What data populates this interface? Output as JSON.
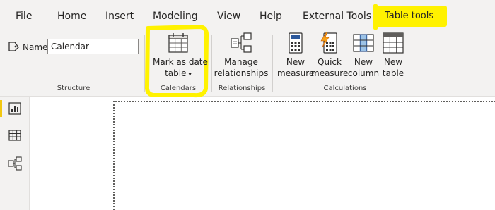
{
  "tabs": [
    {
      "label": "File"
    },
    {
      "label": "Home"
    },
    {
      "label": "Insert"
    },
    {
      "label": "Modeling"
    },
    {
      "label": "View"
    },
    {
      "label": "Help"
    },
    {
      "label": "External Tools"
    },
    {
      "label": "Table tools"
    }
  ],
  "structure": {
    "name_label": "Name",
    "name_value": "Calendar",
    "group_label": "Structure"
  },
  "calendars": {
    "mark_as_date_table_line1": "Mark as date",
    "mark_as_date_table_line2": "table",
    "group_label": "Calendars"
  },
  "relationships": {
    "manage_line1": "Manage",
    "manage_line2": "relationships",
    "group_label": "Relationships"
  },
  "calculations": {
    "new_measure_line1": "New",
    "new_measure_line2": "measure",
    "quick_measure_line1": "Quick",
    "quick_measure_line2": "measure",
    "new_column_line1": "New",
    "new_column_line2": "column",
    "new_table_line1": "New",
    "new_table_line2": "table",
    "group_label": "Calculations"
  },
  "left_nav": [
    {
      "icon": "report-view-icon"
    },
    {
      "icon": "data-view-icon"
    },
    {
      "icon": "model-view-icon"
    }
  ],
  "colors": {
    "highlight": "#fff200",
    "ribbon_bg": "#f3f2f1",
    "accent": "#f2c811"
  }
}
